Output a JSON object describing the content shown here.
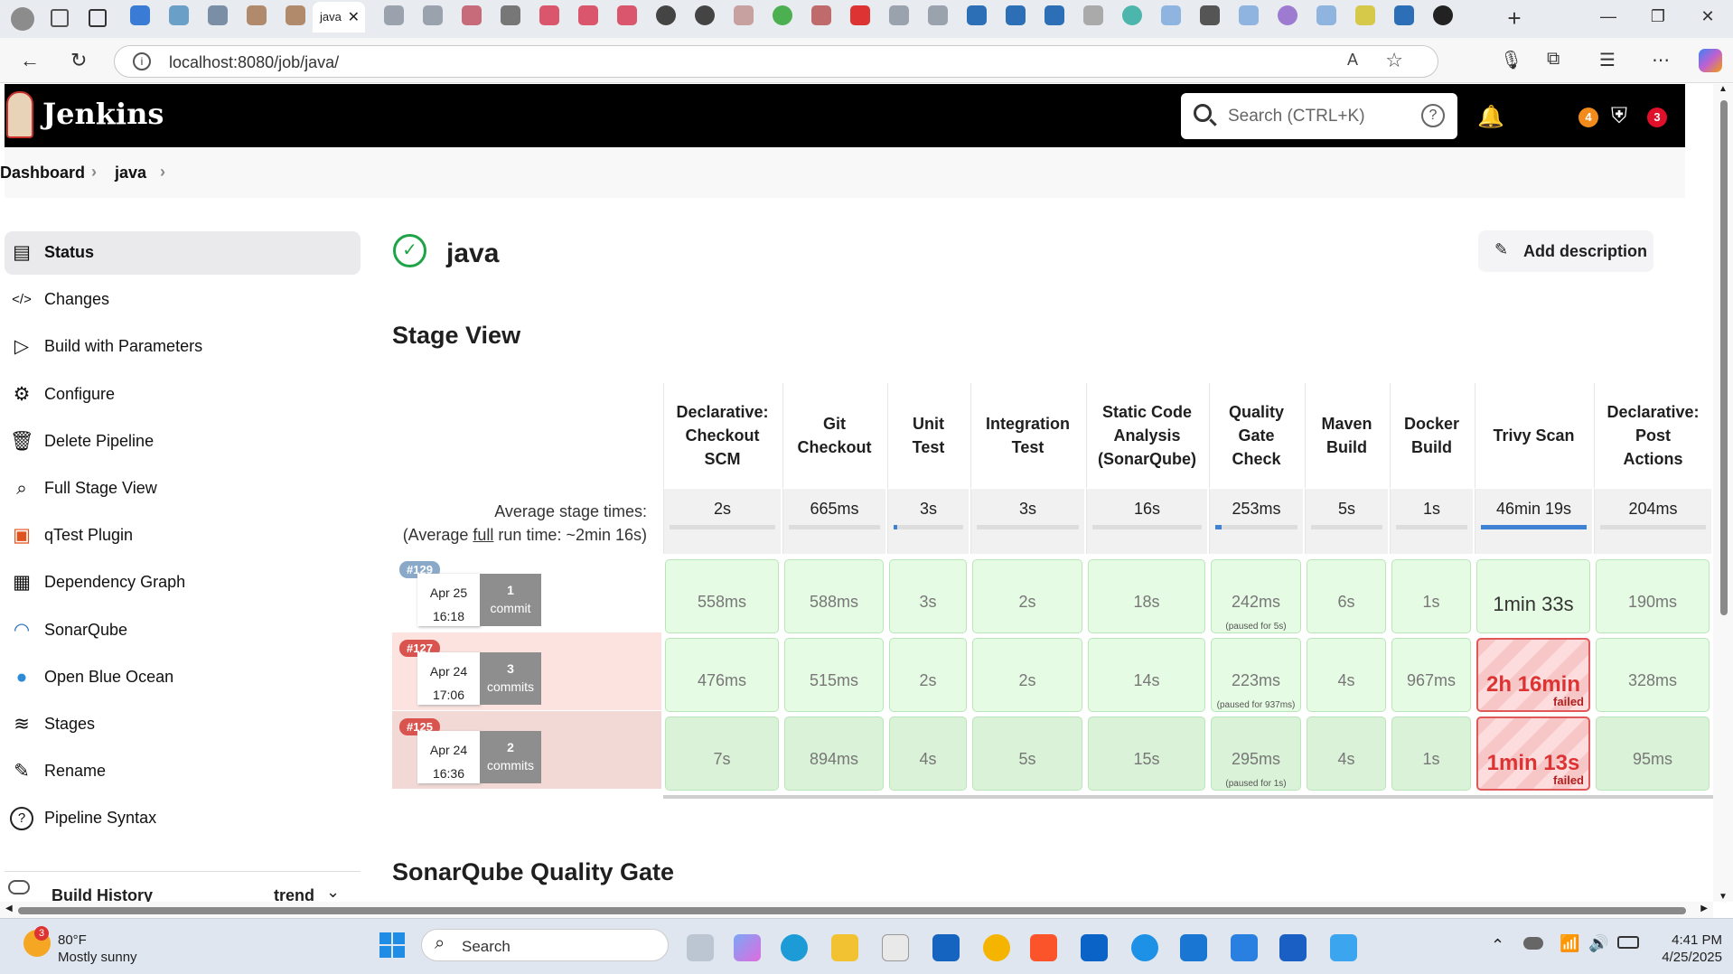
{
  "browser": {
    "tab_title": "java",
    "url": "localhost:8080/job/java/"
  },
  "jenkins": {
    "brand": "Jenkins",
    "search_placeholder": "Search (CTRL+K)",
    "help": "?",
    "notifications_count": "4",
    "security_count": "3"
  },
  "breadcrumb": {
    "items": [
      "Dashboard",
      "java"
    ]
  },
  "sidebar": {
    "items": [
      {
        "label": "Status",
        "icon": "status-doc-icon",
        "selected": true
      },
      {
        "label": "Changes",
        "icon": "code-icon"
      },
      {
        "label": "Build with Parameters",
        "icon": "play-icon"
      },
      {
        "label": "Configure",
        "icon": "gear-icon"
      },
      {
        "label": "Delete Pipeline",
        "icon": "trash-icon"
      },
      {
        "label": "Full Stage View",
        "icon": "search-icon"
      },
      {
        "label": "qTest Plugin",
        "icon": "qtest-icon"
      },
      {
        "label": "Dependency Graph",
        "icon": "graph-icon"
      },
      {
        "label": "SonarQube",
        "icon": "sonarqube-icon"
      },
      {
        "label": "Open Blue Ocean",
        "icon": "blue-ocean-icon"
      },
      {
        "label": "Stages",
        "icon": "layers-icon"
      },
      {
        "label": "Rename",
        "icon": "pencil-icon"
      },
      {
        "label": "Pipeline Syntax",
        "icon": "help-circle-icon"
      }
    ],
    "build_history": {
      "title": "Build History",
      "trend": "trend"
    }
  },
  "main": {
    "job_name": "java",
    "add_description": "Add description",
    "stage_view_title": "Stage View",
    "avg_label_line1": "Average stage times:",
    "avg_label_line2_prefix": "(Average ",
    "avg_label_line2_link": "full",
    "avg_label_line2_suffix": " run time: ~2min 16s)",
    "sonar_title": "SonarQube Quality Gate"
  },
  "stages": {
    "headers": [
      "Declarative: Checkout SCM",
      "Git Checkout",
      "Unit Test",
      "Integration Test",
      "Static Code Analysis (SonarQube)",
      "Quality Gate Check",
      "Maven Build",
      "Docker Build",
      "Trivy Scan",
      "Declarative: Post Actions"
    ],
    "header_lines": [
      [
        "Declarative:",
        "Checkout",
        "SCM"
      ],
      [
        "Git",
        "Checkout"
      ],
      [
        "Unit",
        "Test"
      ],
      [
        "Integration",
        "Test"
      ],
      [
        "Static Code",
        "Analysis",
        "(SonarQube)"
      ],
      [
        "Quality",
        "Gate",
        "Check"
      ],
      [
        "Maven",
        "Build"
      ],
      [
        "Docker",
        "Build"
      ],
      [
        "Trivy Scan"
      ],
      [
        "Declarative:",
        "Post",
        "Actions"
      ]
    ],
    "averages": [
      "2s",
      "665ms",
      "3s",
      "3s",
      "16s",
      "253ms",
      "5s",
      "1s",
      "46min 19s",
      "204ms"
    ],
    "average_progress": [
      0,
      0,
      0.05,
      0,
      0,
      0.08,
      0,
      0,
      1,
      0
    ],
    "runs": [
      {
        "build": "#129",
        "badge_color": "#8aa9c9",
        "date": "Apr 25",
        "time": "16:18",
        "commits_n": "1",
        "commits_label": "commit",
        "row_bg": "#ffffff",
        "cells": [
          {
            "v": "558ms"
          },
          {
            "v": "588ms"
          },
          {
            "v": "3s"
          },
          {
            "v": "2s"
          },
          {
            "v": "18s"
          },
          {
            "v": "242ms",
            "p": "(paused for 5s)"
          },
          {
            "v": "6s"
          },
          {
            "v": "1s"
          },
          {
            "v": "1min 33s",
            "big": true
          },
          {
            "v": "190ms"
          }
        ]
      },
      {
        "build": "#127",
        "badge_color": "#d9534f",
        "date": "Apr 24",
        "time": "17:06",
        "commits_n": "3",
        "commits_label": "commits",
        "row_bg": "#fde3df",
        "cells": [
          {
            "v": "476ms"
          },
          {
            "v": "515ms"
          },
          {
            "v": "2s"
          },
          {
            "v": "2s"
          },
          {
            "v": "14s"
          },
          {
            "v": "223ms",
            "p": "(paused for 937ms)"
          },
          {
            "v": "4s"
          },
          {
            "v": "967ms"
          },
          {
            "v": "2h 16min",
            "fail": true,
            "f": "failed"
          },
          {
            "v": "328ms"
          }
        ]
      },
      {
        "build": "#125",
        "badge_color": "#d9534f",
        "date": "Apr 24",
        "time": "16:36",
        "commits_n": "2",
        "commits_label": "commits",
        "row_bg": "#f3d9d6",
        "cells": [
          {
            "v": "7s"
          },
          {
            "v": "894ms"
          },
          {
            "v": "4s"
          },
          {
            "v": "5s"
          },
          {
            "v": "15s"
          },
          {
            "v": "295ms",
            "p": "(paused for 1s)"
          },
          {
            "v": "4s"
          },
          {
            "v": "1s"
          },
          {
            "v": "1min 13s",
            "fail": true,
            "f": "failed"
          },
          {
            "v": "95ms"
          }
        ]
      }
    ]
  },
  "taskbar": {
    "weather_temp": "80°F",
    "weather_desc": "Mostly sunny",
    "weather_badge": "3",
    "search_label": "Search",
    "time": "4:41 PM",
    "date": "4/25/2025"
  }
}
